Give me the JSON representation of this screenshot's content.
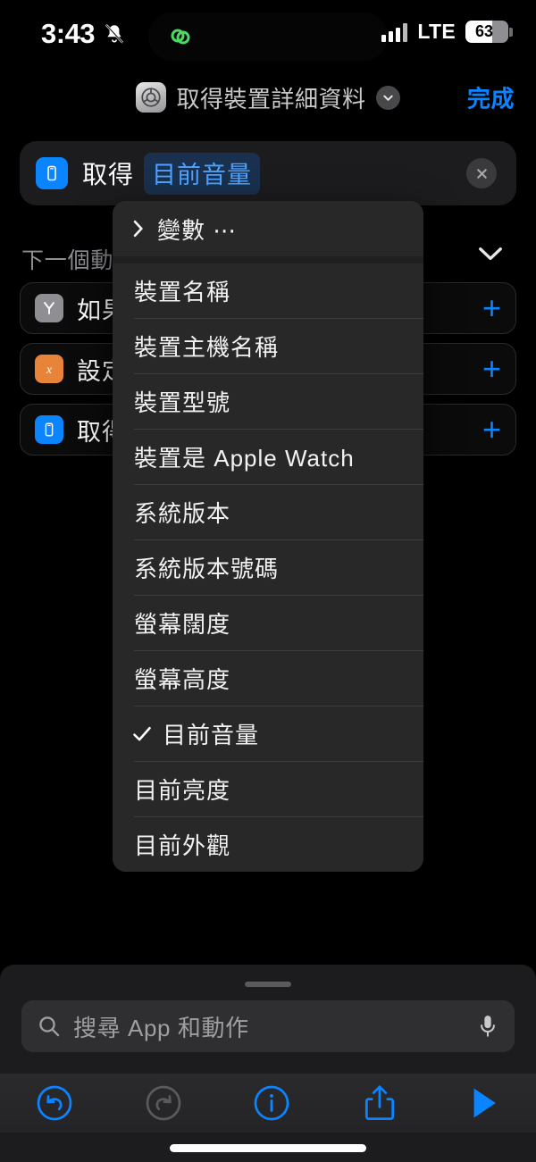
{
  "status_bar": {
    "time": "3:43",
    "silent_icon": "bell-slash-icon",
    "dynamic_island_icon": "phone-link-rings-icon",
    "signal_icon": "cellular-signal-icon",
    "network": "LTE",
    "battery_percent": "63",
    "battery_level": 63
  },
  "nav_bar": {
    "shortcut_icon": "shortcut-glyph-icon",
    "title": "取得裝置詳細資料",
    "chevron_icon": "chevron-down-icon",
    "done_label": "完成"
  },
  "action": {
    "icon": "device-phone-icon",
    "verb": "取得",
    "parameter_token": "目前音量",
    "close_icon": "close-x-icon"
  },
  "suggestions": {
    "header": "下一個動作",
    "collapse_icon": "chevron-down-icon",
    "add_icon": "plus-icon",
    "rows": [
      {
        "icon": "branch-if-icon",
        "label": "如果",
        "add": "+"
      },
      {
        "icon": "variable-x-icon",
        "label": "設定",
        "add": "+"
      },
      {
        "icon": "device-phone-icon",
        "label": "取得",
        "add": "+"
      }
    ]
  },
  "context_menu": {
    "variables_label": "變數 ⋯",
    "variables_chevron": "chevron-right-icon",
    "check_icon": "checkmark-icon",
    "selected": "目前音量",
    "items": [
      {
        "label": "裝置名稱",
        "checked": false
      },
      {
        "label": "裝置主機名稱",
        "checked": false
      },
      {
        "label": "裝置型號",
        "checked": false
      },
      {
        "label": "裝置是 Apple Watch",
        "checked": false
      },
      {
        "label": "系統版本",
        "checked": false
      },
      {
        "label": "系統版本號碼",
        "checked": false
      },
      {
        "label": "螢幕闊度",
        "checked": false
      },
      {
        "label": "螢幕高度",
        "checked": false
      },
      {
        "label": "目前音量",
        "checked": true
      },
      {
        "label": "目前亮度",
        "checked": false
      },
      {
        "label": "目前外觀",
        "checked": false
      }
    ]
  },
  "bottom_sheet": {
    "search": {
      "placeholder": "搜尋 App 和動作",
      "value": "",
      "search_icon": "search-icon",
      "mic_icon": "microphone-icon"
    },
    "toolbar": [
      {
        "name": "undo-button",
        "icon": "undo-arrow-icon",
        "enabled": true
      },
      {
        "name": "redo-button",
        "icon": "redo-arrow-icon",
        "enabled": false
      },
      {
        "name": "info-button",
        "icon": "info-circle-icon",
        "enabled": true
      },
      {
        "name": "share-button",
        "icon": "share-icon",
        "enabled": true
      },
      {
        "name": "run-button",
        "icon": "play-icon",
        "enabled": true
      }
    ]
  },
  "colors": {
    "accent_blue": "#0a84ff",
    "token_blue_text": "#4ea2ff",
    "token_blue_bg": "#19314e",
    "orange": "#e8833a",
    "gray": "#8e8e93",
    "menu_bg": "#282828",
    "card_bg": "#1c1c1e"
  }
}
